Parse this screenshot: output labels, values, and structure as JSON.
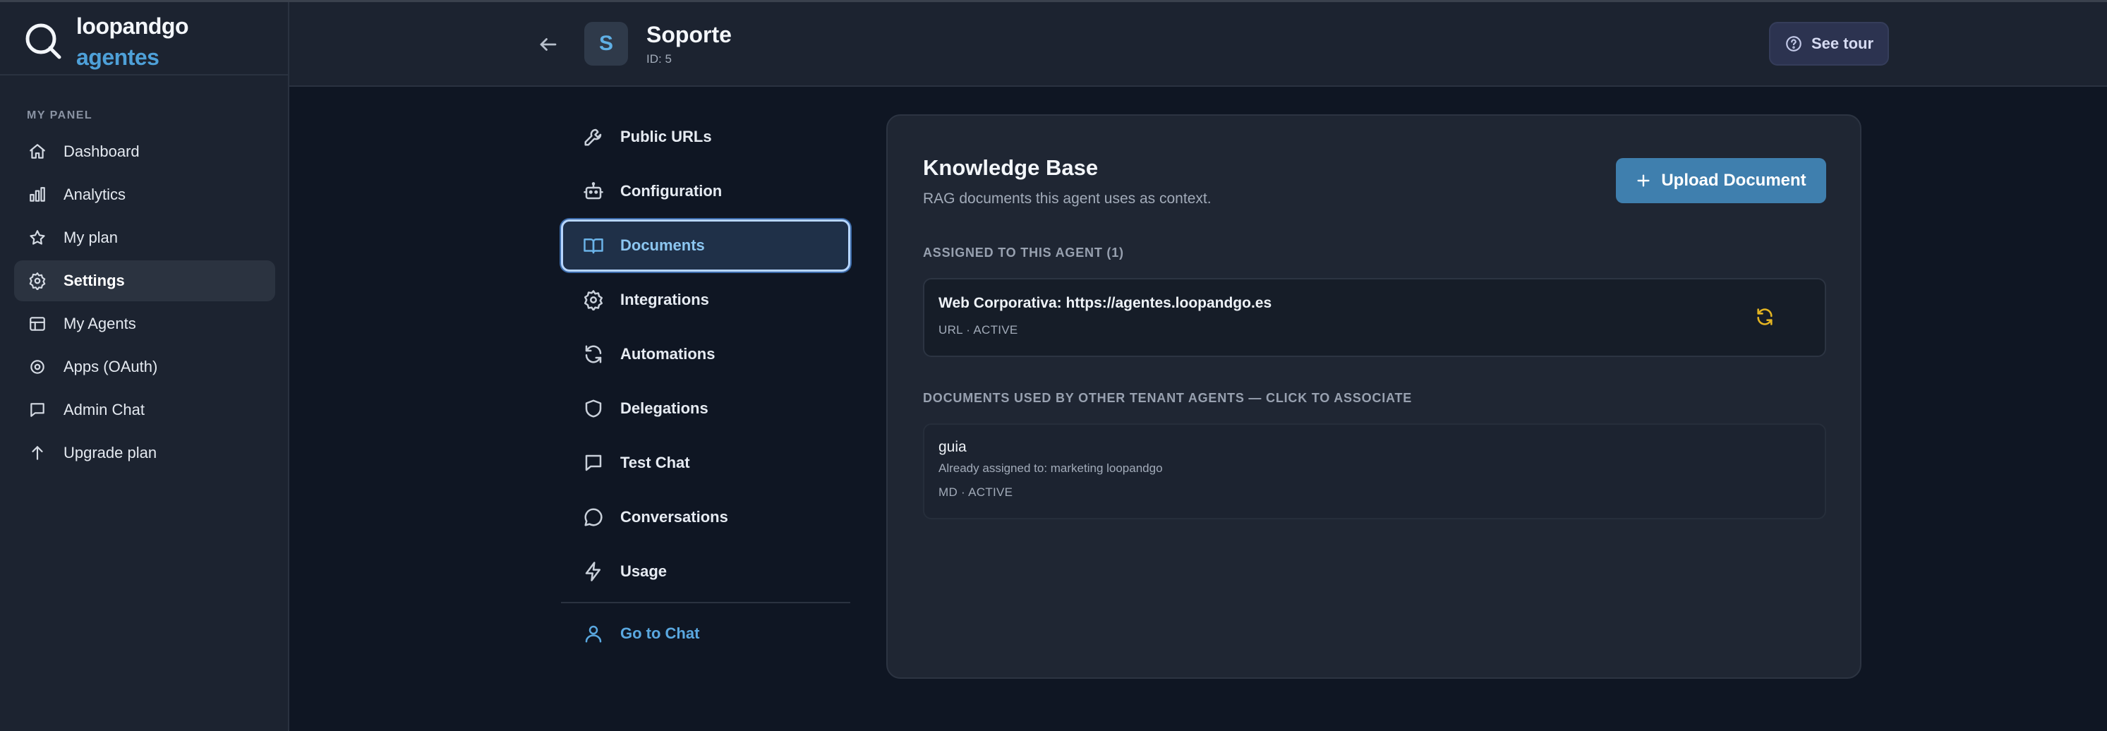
{
  "brand": {
    "name_line1": "loopandgo",
    "name_line2": "agentes"
  },
  "sidebar": {
    "section_label": "MY PANEL",
    "items": [
      {
        "label": "Dashboard",
        "icon": "home-icon"
      },
      {
        "label": "Analytics",
        "icon": "bar-chart-icon"
      },
      {
        "label": "My plan",
        "icon": "star-icon"
      },
      {
        "label": "Settings",
        "icon": "gear-icon",
        "active": true
      },
      {
        "label": "My Agents",
        "icon": "table-icon"
      },
      {
        "label": "Apps (OAuth)",
        "icon": "cog-icon"
      },
      {
        "label": "Admin Chat",
        "icon": "chat-square-icon"
      },
      {
        "label": "Upgrade plan",
        "icon": "arrow-up-icon"
      }
    ]
  },
  "header": {
    "avatar_letter": "S",
    "agent_name": "Soporte",
    "agent_id": "ID: 5",
    "tour_label": "See tour"
  },
  "agent_nav": {
    "items": [
      {
        "label": "Public URLs",
        "icon": "wrench-icon"
      },
      {
        "label": "Configuration",
        "icon": "bot-icon"
      },
      {
        "label": "Documents",
        "icon": "book-open-icon",
        "active": true
      },
      {
        "label": "Integrations",
        "icon": "gear-icon"
      },
      {
        "label": "Automations",
        "icon": "refresh-icon"
      },
      {
        "label": "Delegations",
        "icon": "shield-icon"
      },
      {
        "label": "Test Chat",
        "icon": "chat-square-icon"
      },
      {
        "label": "Conversations",
        "icon": "chat-round-icon"
      },
      {
        "label": "Usage",
        "icon": "lightning-icon"
      }
    ],
    "go_to_chat": "Go to Chat"
  },
  "knowledge_base": {
    "title": "Knowledge Base",
    "subtitle": "RAG documents this agent uses as context.",
    "upload_label": "Upload Document",
    "assigned_label": "ASSIGNED TO THIS AGENT (1)",
    "assigned": [
      {
        "title": "Web Corporativa: https://agentes.loopandgo.es",
        "meta": "URL · ACTIVE"
      }
    ],
    "other_label": "DOCUMENTS USED BY OTHER TENANT AGENTS — CLICK TO ASSOCIATE",
    "other": [
      {
        "title": "guia",
        "note": "Already assigned to: marketing loopandgo",
        "meta": "MD · ACTIVE"
      }
    ]
  },
  "colors": {
    "accent": "#4ea0d8",
    "primary_button": "#3f7fae",
    "sync_icon": "#e3b422",
    "background": "#0f1623",
    "panel": "#1c2330"
  }
}
